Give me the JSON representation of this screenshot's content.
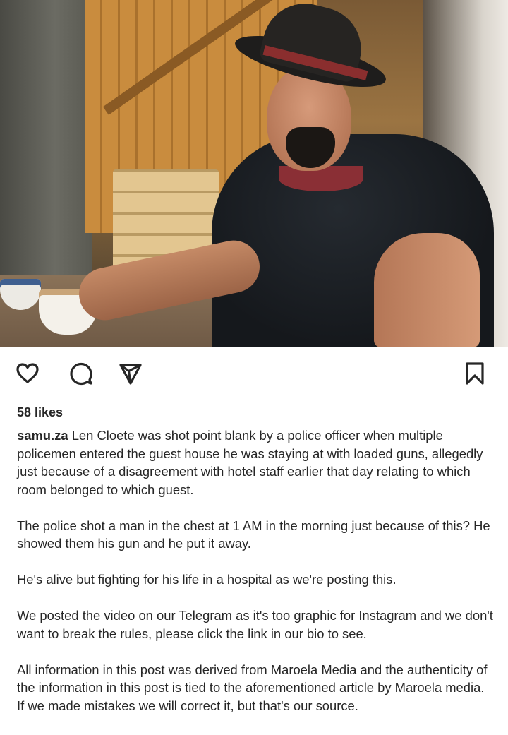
{
  "post": {
    "image_alt": "photo-man-in-cowboy-hat",
    "actions": {
      "like_icon": "heart-outline-icon",
      "comment_icon": "comment-bubble-icon",
      "share_icon": "paper-plane-icon",
      "save_icon": "bookmark-icon"
    },
    "likes": "58 likes",
    "username": "samu.za",
    "caption": {
      "p1": " Len Cloete was shot point blank by a police officer when multiple policemen entered the guest house he was staying at with loaded guns, allegedly just because of a disagreement with hotel staff earlier that day relating to which room belonged to which guest.",
      "p2": "The police shot a man in the chest at 1 AM in the morning just because of this? He showed them his gun and he put it away.",
      "p3": "He's alive but fighting for his life in a hospital as we're posting this.",
      "p4": "We posted the video on our Telegram as it's too graphic for Instagram and we don't want to break the rules, please click the link in our bio to see.",
      "p5": "All information in this post was derived from Maroela Media and the authenticity of the information in this post is tied to the aforementioned article by Maroela media. If we made mistakes we will correct it, but that's our source."
    }
  }
}
